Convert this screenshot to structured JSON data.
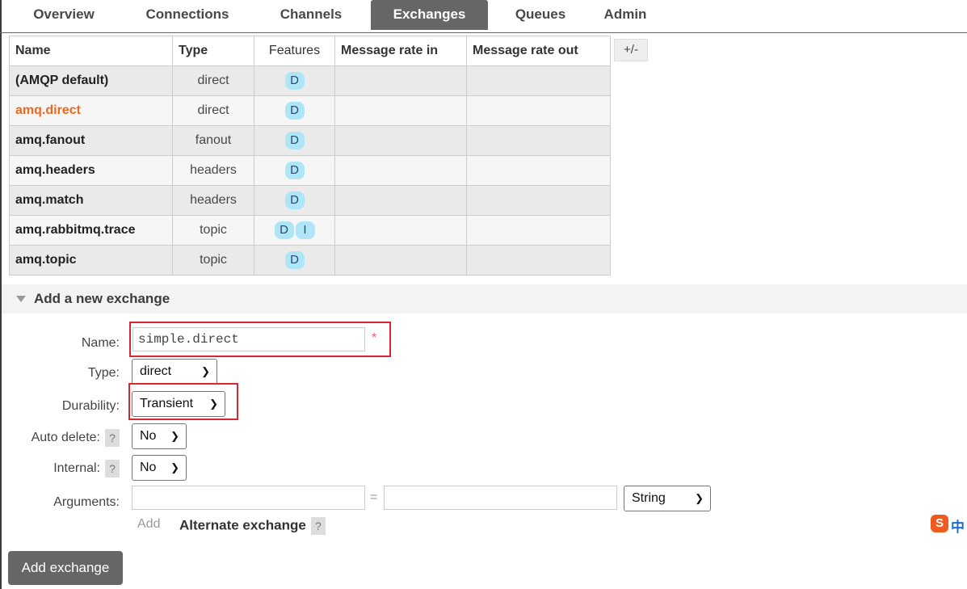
{
  "tabs": [
    "Overview",
    "Connections",
    "Channels",
    "Exchanges",
    "Queues",
    "Admin"
  ],
  "active_tab": "Exchanges",
  "table": {
    "headers": {
      "name": "Name",
      "type": "Type",
      "features": "Features",
      "rate_in": "Message rate in",
      "rate_out": "Message rate out"
    },
    "columns_toggle": "+/-",
    "rows": [
      {
        "name": "(AMQP default)",
        "type": "direct",
        "features": [
          "D"
        ]
      },
      {
        "name": "amq.direct",
        "type": "direct",
        "features": [
          "D"
        ]
      },
      {
        "name": "amq.fanout",
        "type": "fanout",
        "features": [
          "D"
        ]
      },
      {
        "name": "amq.headers",
        "type": "headers",
        "features": [
          "D"
        ]
      },
      {
        "name": "amq.match",
        "type": "headers",
        "features": [
          "D"
        ]
      },
      {
        "name": "amq.rabbitmq.trace",
        "type": "topic",
        "features": [
          "D",
          "I"
        ]
      },
      {
        "name": "amq.topic",
        "type": "topic",
        "features": [
          "D"
        ]
      }
    ]
  },
  "form": {
    "section_title": "Add a new exchange",
    "name_label": "Name:",
    "name_value": "simple.direct",
    "required_mark": "*",
    "type_label": "Type:",
    "type_value": "direct",
    "durability_label": "Durability:",
    "durability_value": "Transient",
    "auto_delete_label": "Auto delete:",
    "auto_delete_value": "No",
    "internal_label": "Internal:",
    "internal_value": "No",
    "help_mark": "?",
    "arguments_label": "Arguments:",
    "arg_key": "",
    "arg_value": "",
    "equals": "=",
    "arg_type": "String",
    "add_link": "Add",
    "alternate_exchange": "Alternate exchange",
    "submit": "Add exchange"
  },
  "ime": {
    "logo": "S",
    "mode": "中"
  },
  "colors": {
    "highlight_name": "#f0671f",
    "badge_bg": "#aee6f8",
    "tab_active_bg": "#666666",
    "annotation_box": "#d9272e"
  }
}
